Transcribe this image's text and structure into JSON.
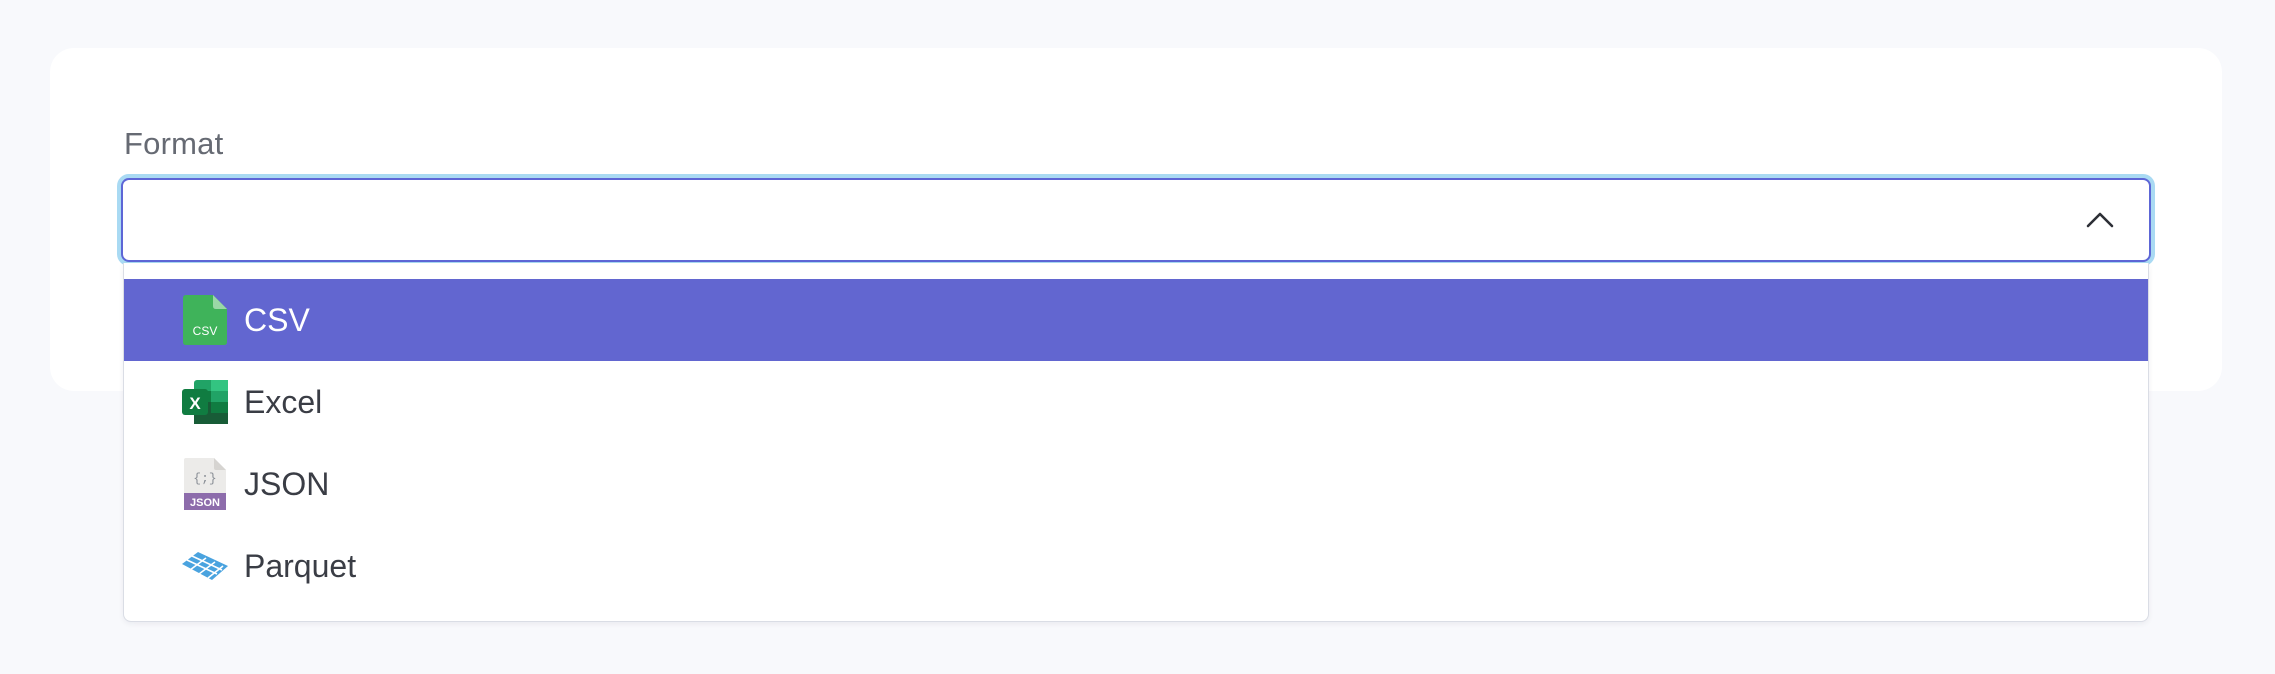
{
  "form": {
    "format_label": "Format",
    "select": {
      "value": "",
      "expanded": true
    }
  },
  "dropdown": {
    "options": [
      {
        "label": "CSV",
        "icon": "csv-file-icon",
        "icon_text": "CSV",
        "selected": true
      },
      {
        "label": "Excel",
        "icon": "excel-icon",
        "icon_text": "X",
        "selected": false
      },
      {
        "label": "JSON",
        "icon": "json-file-icon",
        "icon_text": "{;}",
        "icon_badge": "JSON",
        "selected": false
      },
      {
        "label": "Parquet",
        "icon": "parquet-icon",
        "selected": false
      }
    ]
  },
  "colors": {
    "highlight": "#6266d0",
    "focus_ring": "#a9daf3",
    "border": "#5d66d6",
    "csv_green": "#3fb35a",
    "excel_green": "#1d7a45",
    "json_purple": "#8d6cab",
    "parquet_blue": "#4aa3df"
  }
}
